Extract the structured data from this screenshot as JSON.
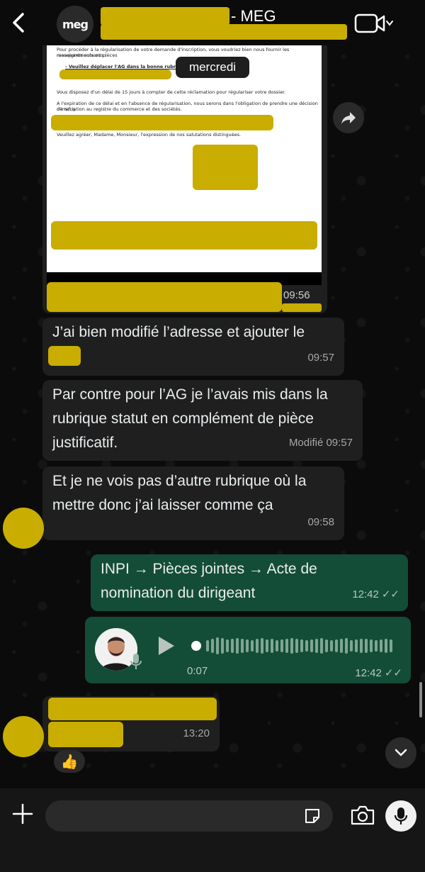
{
  "header": {
    "title": "- MEG",
    "logo_text": "meg"
  },
  "date_chip": "mercredi",
  "document": {
    "lines": [
      "Pour procéder à la régularisation de votre demande d'inscription, vous voudriez bien nous fournir les renseignements ou pièces",
      "manquants suivants :",
      "- Veuillez déplacer l'AG dans la bonne rubrique",
      "Vous disposez d'un délai de 15 jours à compter de cette réclamation pour régulariser votre dossier.",
      "A l'expiration de ce délai et en l'absence de régularisation, nous serons dans l'obligation de prendre une décision de refus",
      "d'inscription au registre du commerce et des sociétés.",
      "Veuillez agréer, Madame, Monsieur, l'expression de nos salutations distinguées."
    ],
    "time": "09:56"
  },
  "messages": [
    {
      "text": "J’ai bien modifié l’adresse et ajouter le",
      "time": "09:57"
    },
    {
      "text": "Par contre pour l’AG je l’avais mis dans la rubrique statut en complément de pièce justificatif.",
      "meta": "Modifié 09:57"
    },
    {
      "text": "Et je ne vois pas d’autre rubrique où la mettre donc j’ai laisser comme ça",
      "time": "09:58"
    },
    {
      "text": "INPI → Pièces jointes → Acte de nomination du dirigeant",
      "time": "12:42",
      "ticks": "✓✓"
    }
  ],
  "voice": {
    "duration": "0:07",
    "time": "12:42",
    "ticks": "✓✓"
  },
  "last_message": {
    "time": "13:20",
    "reaction": "👍"
  },
  "composer": {
    "placeholder": ""
  }
}
